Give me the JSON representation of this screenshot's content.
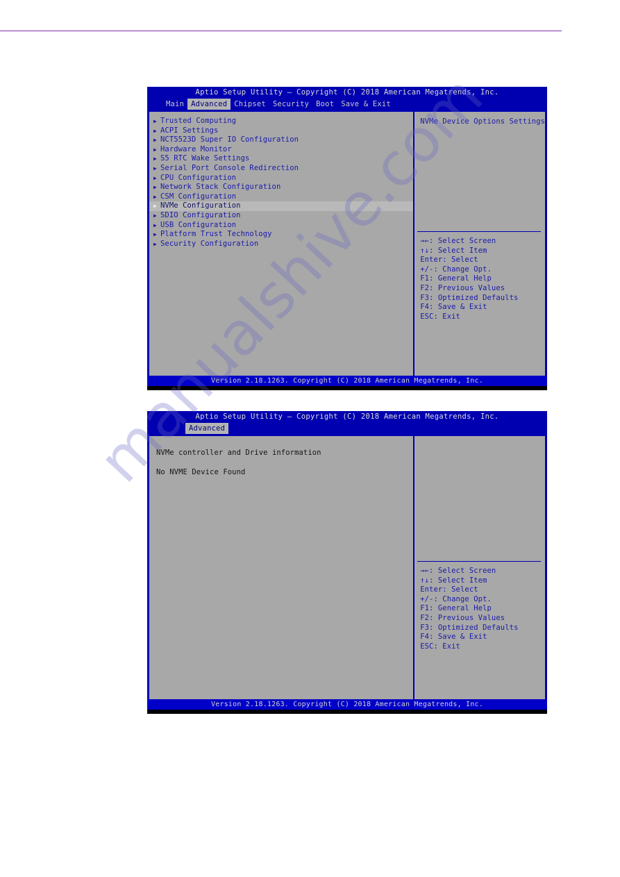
{
  "page": {
    "rule_color": "#7b2fa8",
    "watermark": "manualshive.com"
  },
  "screen1": {
    "title": "Aptio Setup Utility – Copyright (C) 2018 American Megatrends, Inc.",
    "tabs": [
      {
        "label": "Main",
        "selected": false
      },
      {
        "label": "Advanced",
        "selected": true
      },
      {
        "label": "Chipset",
        "selected": false
      },
      {
        "label": "Security",
        "selected": false
      },
      {
        "label": "Boot",
        "selected": false
      },
      {
        "label": "Save & Exit",
        "selected": false
      }
    ],
    "menu_items": [
      {
        "label": "Trusted Computing",
        "highlighted": false
      },
      {
        "label": "ACPI Settings",
        "highlighted": false
      },
      {
        "label": "NCT5523D Super IO Configuration",
        "highlighted": false
      },
      {
        "label": "Hardware Monitor",
        "highlighted": false
      },
      {
        "label": "S5 RTC Wake Settings",
        "highlighted": false
      },
      {
        "label": "Serial Port Console Redirection",
        "highlighted": false
      },
      {
        "label": "CPU Configuration",
        "highlighted": false
      },
      {
        "label": "Network Stack Configuration",
        "highlighted": false
      },
      {
        "label": "CSM Configuration",
        "highlighted": false
      },
      {
        "label": "NVMe Configuration",
        "highlighted": true
      },
      {
        "label": "SDIO Configuration",
        "highlighted": false
      },
      {
        "label": "USB Configuration",
        "highlighted": false
      },
      {
        "label": "Platform Trust Technology",
        "highlighted": false
      },
      {
        "label": "Security Configuration",
        "highlighted": false
      }
    ],
    "help_title": "NVMe Device Options Settings",
    "help_keys": [
      "→←: Select Screen",
      "↑↓: Select Item",
      "Enter: Select",
      "+/-: Change Opt.",
      "F1: General Help",
      "F2: Previous Values",
      "F3: Optimized Defaults",
      "F4: Save & Exit",
      "ESC: Exit"
    ],
    "footer": "Version 2.18.1263. Copyright (C) 2018 American Megatrends, Inc."
  },
  "screen2": {
    "title": "Aptio Setup Utility – Copyright (C) 2018 American Megatrends, Inc.",
    "tabs": [
      {
        "label": "Advanced",
        "selected": true
      }
    ],
    "info_lines": [
      "NVMe controller and Drive information",
      "No NVME Device Found"
    ],
    "help_keys": [
      "→←: Select Screen",
      "↑↓: Select Item",
      "Enter: Select",
      "+/-: Change Opt.",
      "F1: General Help",
      "F2: Previous Values",
      "F3: Optimized Defaults",
      "F4: Save & Exit",
      "ESC: Exit"
    ],
    "footer": "Version 2.18.1263. Copyright (C) 2018 American Megatrends, Inc."
  }
}
